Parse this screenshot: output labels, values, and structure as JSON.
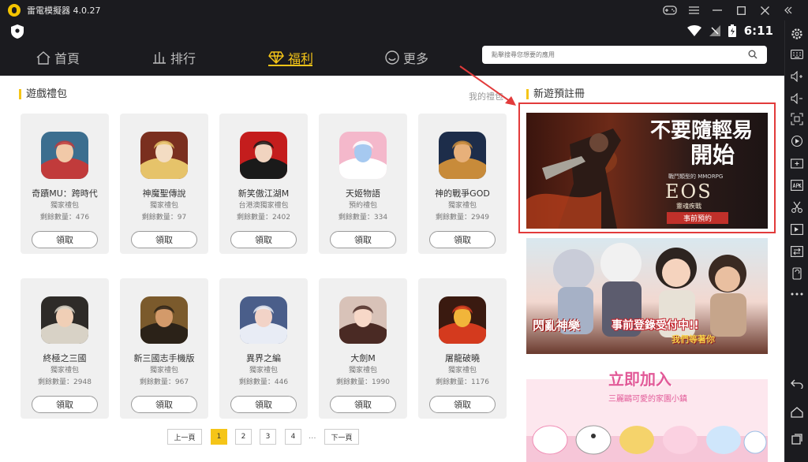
{
  "app": {
    "title": "雷電模擬器 4.0.27"
  },
  "status": {
    "time": "6:11"
  },
  "nav": {
    "tabs": [
      {
        "label": "首頁",
        "icon": "home-icon",
        "active": false
      },
      {
        "label": "排行",
        "icon": "ranking-icon",
        "active": false
      },
      {
        "label": "福利",
        "icon": "diamond-icon",
        "active": true
      },
      {
        "label": "更多",
        "icon": "smile-icon",
        "active": false
      }
    ],
    "search_placeholder": "點擊搜尋您想要的應用"
  },
  "gifts": {
    "title": "遊戲禮包",
    "more_link": "我的禮包",
    "claim_label": "領取",
    "items": [
      {
        "name": "奇蹟MU：跨時代",
        "type": "獨家禮包",
        "count": "剩餘數量：476"
      },
      {
        "name": "神魔聖傳說",
        "type": "獨家禮包",
        "count": "剩餘數量：97"
      },
      {
        "name": "新笑傲江湖M",
        "type": "台港澳獨家禮包",
        "count": "剩餘數量：2402"
      },
      {
        "name": "天姬物語",
        "type": "預約禮包",
        "count": "剩餘數量：334"
      },
      {
        "name": "神的戰爭GOD",
        "type": "獨家禮包",
        "count": "剩餘數量：2949"
      },
      {
        "name": "終極之三國",
        "type": "獨家禮包",
        "count": "剩餘數量：2948"
      },
      {
        "name": "新三國志手機版",
        "type": "獨家禮包",
        "count": "剩餘數量：967"
      },
      {
        "name": "異界之編",
        "type": "獨家禮包",
        "count": "剩餘數量：446"
      },
      {
        "name": "大劍M",
        "type": "獨家禮包",
        "count": "剩餘數量：1990"
      },
      {
        "name": "屠龍破曉",
        "type": "獨家禮包",
        "count": "剩餘數量：1176"
      }
    ]
  },
  "pagination": {
    "prev": "上一頁",
    "pages": [
      "1",
      "2",
      "3",
      "4"
    ],
    "current": "1",
    "ellipsis": "...",
    "next": "下一頁"
  },
  "preregister": {
    "title": "新遊預註冊",
    "banners": [
      {
        "headline1": "不要隨輕易",
        "headline2": "開始",
        "subtitle": "戰鬥類型的 MMORPG",
        "game": "EOS",
        "game_sub": "靈魂疾戰",
        "cta": "事前預約"
      },
      {
        "logo_text": "閃亂神樂",
        "cta": "事前登錄受付中!!",
        "cta2": "我們等著你"
      },
      {
        "headline": "立即加入",
        "sub": "三麗鷗可愛的家園小鎮"
      }
    ]
  },
  "colors": {
    "accent": "#f5c518",
    "highlight": "#e23b3b",
    "chrome": "#1b1b1f"
  }
}
